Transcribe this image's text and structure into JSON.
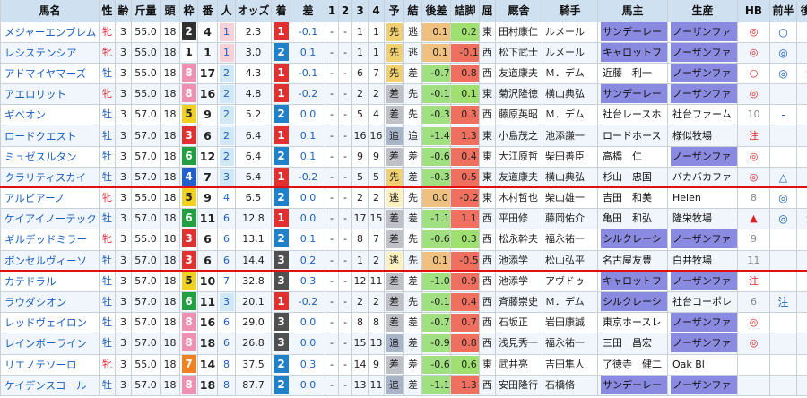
{
  "headers": [
    "馬名",
    "性",
    "齢",
    "斤量",
    "頭",
    "枠",
    "番",
    "人",
    "オッズ",
    "着",
    "差",
    "1",
    "2",
    "3",
    "4",
    "予",
    "結",
    "後差",
    "詰脚",
    "屈",
    "厩舎",
    "騎手",
    "馬主",
    "生産",
    "HB",
    "前半",
    "後半"
  ],
  "colors": {
    "waku": {
      "1": "#ffffff",
      "2": "#303030",
      "3": "#e03030",
      "4": "#2060d0",
      "5": "#f0d020",
      "6": "#20a040",
      "7": "#f08020",
      "8": "#f090b0"
    },
    "chaku": {
      "1": "#e03030",
      "2": "#2080c8",
      "3": "#505050",
      "other": "#f0f0f0"
    },
    "style_saki": "#f0d070",
    "style_sa": "#c0c0c8",
    "style_oi": "#a8b4c8",
    "style_nige": "#fff0c0",
    "owner_sunday": "#8a8ae0",
    "owner_carrot": "#8a8ae0",
    "farm_northern": "#8a8ae0",
    "kouhan_orange": "#f0c080",
    "kouhan_green": "#a0e080",
    "tsume_red": "#f07060",
    "tsume_green": "#a0e070",
    "owner_silk": "#8a8ae0",
    "ninki_pink": "#f8d0d8",
    "ninki_lightblue": "#d0e8f8"
  },
  "rows": [
    {
      "name": "メジャーエンブレム",
      "sex": "牝",
      "age": "3",
      "kin": "55.0",
      "tou": "18",
      "waku": "2",
      "ban": "4",
      "nin": "1",
      "odds": "2.3",
      "chaku": "1",
      "sa": "-0.1",
      "c1": "-",
      "c2": "-",
      "c3": "1",
      "c4": "1",
      "yo": "先",
      "ketsu": "逃",
      "kohan": "0.1",
      "kohan_c": "orange",
      "tsume": "0.2",
      "tsume_c": "green",
      "kutsu": "東",
      "stable": "田村康仁",
      "jockey": "ルメール",
      "owner": "サンデーレー",
      "owner_hl": true,
      "farm": "ノーザンファ",
      "farm_hl": true,
      "hb": "◎",
      "zen": "○",
      "kou": "▲"
    },
    {
      "name": "レシステンシア",
      "sex": "牝",
      "age": "3",
      "kin": "55.0",
      "tou": "18",
      "waku": "1",
      "ban": "1",
      "nin": "1",
      "odds": "3.0",
      "chaku": "2",
      "sa": "0.1",
      "c1": "-",
      "c2": "-",
      "c3": "1",
      "c4": "1",
      "yo": "先",
      "ketsu": "逃",
      "kohan": "0.1",
      "kohan_c": "orange",
      "tsume": "-0.1",
      "tsume_c": "red",
      "kutsu": "西",
      "stable": "松下武士",
      "jockey": "ルメール",
      "owner": "キャロットフ",
      "owner_hl": true,
      "farm": "ノーザンファ",
      "farm_hl": true,
      "hb": "◎",
      "zen": "◎",
      "kou": ""
    },
    {
      "name": "アドマイヤマーズ",
      "sex": "牡",
      "age": "3",
      "kin": "55.0",
      "tou": "18",
      "waku": "8",
      "ban": "17",
      "nin": "2",
      "odds": "4.3",
      "chaku": "1",
      "sa": "-0.1",
      "c1": "-",
      "c2": "-",
      "c3": "6",
      "c4": "7",
      "yo": "先",
      "ketsu": "差",
      "kohan": "-0.7",
      "kohan_c": "green",
      "tsume": "0.8",
      "tsume_c": "red",
      "kutsu": "西",
      "stable": "友道康夫",
      "jockey": "Ｍ．デム",
      "owner": "近藤　利一",
      "owner_hl": false,
      "farm": "ノーザンファ",
      "farm_hl": true,
      "hb": "○",
      "zen": "◎",
      "kou": "注"
    },
    {
      "name": "アエロリット",
      "sex": "牝",
      "age": "3",
      "kin": "55.0",
      "tou": "18",
      "waku": "8",
      "ban": "16",
      "nin": "2",
      "odds": "4.8",
      "chaku": "1",
      "sa": "-0.2",
      "c1": "-",
      "c2": "-",
      "c3": "2",
      "c4": "2",
      "yo": "差",
      "ketsu": "先",
      "kohan": "-0.1",
      "kohan_c": "green",
      "tsume": "0.1",
      "tsume_c": "green",
      "kutsu": "東",
      "stable": "菊沢隆徳",
      "jockey": "横山典弘",
      "owner": "サンデーレー",
      "owner_hl": true,
      "farm": "ノーザンファ",
      "farm_hl": true,
      "hb": "◎",
      "zen": "",
      "kou": "◎"
    },
    {
      "name": "ギベオン",
      "sex": "牡",
      "age": "3",
      "kin": "57.0",
      "tou": "18",
      "waku": "5",
      "ban": "9",
      "nin": "2",
      "odds": "5.2",
      "chaku": "2",
      "sa": "0.0",
      "c1": "-",
      "c2": "-",
      "c3": "5",
      "c4": "4",
      "yo": "差",
      "ketsu": "先",
      "kohan": "-0.3",
      "kohan_c": "green",
      "tsume": "0.3",
      "tsume_c": "red",
      "kutsu": "西",
      "stable": "藤原英昭",
      "jockey": "Ｍ．デム",
      "owner": "社台レースホ",
      "owner_hl": false,
      "farm": "社台ファーム",
      "farm_hl": false,
      "hb": "10",
      "zen": "-",
      "kou": "○"
    },
    {
      "name": "ロードクエスト",
      "sex": "牡",
      "age": "3",
      "kin": "57.0",
      "tou": "18",
      "waku": "3",
      "ban": "6",
      "nin": "2",
      "odds": "6.4",
      "chaku": "1",
      "sa": "0.1",
      "c1": "-",
      "c2": "-",
      "c3": "16",
      "c4": "16",
      "yo": "追",
      "ketsu": "追",
      "kohan": "-1.4",
      "kohan_c": "green",
      "tsume": "1.3",
      "tsume_c": "red",
      "kutsu": "東",
      "stable": "小島茂之",
      "jockey": "池添謙一",
      "owner": "ロードホース",
      "owner_hl": false,
      "farm": "様似牧場",
      "farm_hl": false,
      "hb": "注",
      "zen": "",
      "kou": "◎"
    },
    {
      "name": "ミュゼスルタン",
      "sex": "牡",
      "age": "3",
      "kin": "57.0",
      "tou": "18",
      "waku": "6",
      "ban": "12",
      "nin": "2",
      "odds": "6.4",
      "chaku": "2",
      "sa": "0.1",
      "c1": "-",
      "c2": "-",
      "c3": "9",
      "c4": "9",
      "yo": "差",
      "ketsu": "差",
      "kohan": "-0.6",
      "kohan_c": "green",
      "tsume": "0.4",
      "tsume_c": "red",
      "kutsu": "東",
      "stable": "大江原哲",
      "jockey": "柴田善臣",
      "owner": "高橋　仁",
      "owner_hl": false,
      "farm": "ノーザンファ",
      "farm_hl": true,
      "hb": "◎",
      "zen": "",
      "kou": "▲"
    },
    {
      "name": "クラリティスカイ",
      "sex": "牡",
      "age": "3",
      "kin": "57.0",
      "tou": "18",
      "waku": "4",
      "ban": "7",
      "nin": "3",
      "odds": "6.4",
      "chaku": "1",
      "sa": "-0.2",
      "c1": "-",
      "c2": "-",
      "c3": "5",
      "c4": "5",
      "yo": "先",
      "ketsu": "差",
      "kohan": "-0.3",
      "kohan_c": "green",
      "tsume": "0.5",
      "tsume_c": "red",
      "kutsu": "東",
      "stable": "友道康夫",
      "jockey": "横山典弘",
      "owner": "杉山　忠国",
      "owner_hl": false,
      "farm": "バカバカファ",
      "farm_hl": false,
      "hb": "◎",
      "zen": "△",
      "kou": "△"
    },
    {
      "name": "アルビアーノ",
      "sex": "牝",
      "age": "3",
      "kin": "55.0",
      "tou": "18",
      "waku": "5",
      "ban": "9",
      "nin": "4",
      "odds": "6.5",
      "chaku": "2",
      "sa": "0.0",
      "c1": "-",
      "c2": "-",
      "c3": "2",
      "c4": "2",
      "yo": "逃",
      "ketsu": "先",
      "kohan": "0.0",
      "kohan_c": "orange",
      "tsume": "-0.2",
      "tsume_c": "red",
      "kutsu": "東",
      "stable": "木村哲也",
      "jockey": "柴山雄一",
      "owner": "吉田　和美",
      "owner_hl": false,
      "farm": "Helen",
      "farm_hl": false,
      "hb": "8",
      "zen": "◎",
      "kou": ""
    },
    {
      "name": "ケイアイノーテック",
      "sex": "牡",
      "age": "3",
      "kin": "57.0",
      "tou": "18",
      "waku": "6",
      "ban": "11",
      "nin": "6",
      "odds": "12.8",
      "chaku": "1",
      "sa": "0.0",
      "c1": "-",
      "c2": "-",
      "c3": "17",
      "c4": "15",
      "yo": "差",
      "ketsu": "差",
      "kohan": "-1.1",
      "kohan_c": "green",
      "tsume": "1.1",
      "tsume_c": "red",
      "kutsu": "西",
      "stable": "平田修",
      "jockey": "藤岡佑介",
      "owner": "亀田　和弘",
      "owner_hl": false,
      "farm": "隆栄牧場",
      "farm_hl": false,
      "hb": "▲",
      "zen": "◎",
      "kou": "注"
    },
    {
      "name": "ギルデッドミラー",
      "sex": "牝",
      "age": "3",
      "kin": "55.0",
      "tou": "18",
      "waku": "3",
      "ban": "6",
      "nin": "6",
      "odds": "13.1",
      "chaku": "2",
      "sa": "0.1",
      "c1": "-",
      "c2": "-",
      "c3": "8",
      "c4": "7",
      "yo": "差",
      "ketsu": "先",
      "kohan": "-0.6",
      "kohan_c": "green",
      "tsume": "0.3",
      "tsume_c": "green",
      "kutsu": "西",
      "stable": "松永幹夫",
      "jockey": "福永祐一",
      "owner": "シルクレーシ",
      "owner_hl": true,
      "farm": "ノーザンファ",
      "farm_hl": true,
      "hb": "9",
      "zen": "",
      "kou": ""
    },
    {
      "name": "ボンセルヴィーソ",
      "sex": "牡",
      "age": "3",
      "kin": "57.0",
      "tou": "18",
      "waku": "3",
      "ban": "6",
      "nin": "6",
      "odds": "14.4",
      "chaku": "3",
      "sa": "0.2",
      "c1": "-",
      "c2": "-",
      "c3": "1",
      "c4": "2",
      "yo": "逃",
      "ketsu": "先",
      "kohan": "0.1",
      "kohan_c": "orange",
      "tsume": "-0.5",
      "tsume_c": "red",
      "kutsu": "西",
      "stable": "池添学",
      "jockey": "松山弘平",
      "owner": "名古屋友豊",
      "owner_hl": false,
      "farm": "白井牧場",
      "farm_hl": false,
      "hb": "11",
      "zen": "",
      "kou": ""
    },
    {
      "name": "カテドラル",
      "sex": "牡",
      "age": "3",
      "kin": "57.0",
      "tou": "18",
      "waku": "5",
      "ban": "10",
      "nin": "7",
      "odds": "32.8",
      "chaku": "3",
      "sa": "0.3",
      "c1": "-",
      "c2": "-",
      "c3": "12",
      "c4": "11",
      "yo": "差",
      "ketsu": "差",
      "kohan": "-1.0",
      "kohan_c": "green",
      "tsume": "0.9",
      "tsume_c": "red",
      "kutsu": "西",
      "stable": "池添学",
      "jockey": "アヴドゥ",
      "owner": "キャロットフ",
      "owner_hl": true,
      "farm": "ノーザンファ",
      "farm_hl": true,
      "hb": "注",
      "zen": "",
      "kou": ""
    },
    {
      "name": "ラウダシオン",
      "sex": "牡",
      "age": "3",
      "kin": "57.0",
      "tou": "18",
      "waku": "6",
      "ban": "11",
      "nin": "3",
      "odds": "20.1",
      "chaku": "1",
      "sa": "-0.2",
      "c1": "-",
      "c2": "-",
      "c3": "2",
      "c4": "2",
      "yo": "差",
      "ketsu": "先",
      "kohan": "-0.1",
      "kohan_c": "green",
      "tsume": "0.4",
      "tsume_c": "red",
      "kutsu": "西",
      "stable": "斉藤崇史",
      "jockey": "Ｍ．デム",
      "owner": "シルクレーシ",
      "owner_hl": true,
      "farm": "社台コーポレ",
      "farm_hl": false,
      "hb": "6",
      "zen": "注",
      "kou": ""
    },
    {
      "name": "レッドヴェイロン",
      "sex": "牡",
      "age": "3",
      "kin": "57.0",
      "tou": "18",
      "waku": "8",
      "ban": "16",
      "nin": "6",
      "odds": "29.0",
      "chaku": "3",
      "sa": "0.0",
      "c1": "-",
      "c2": "-",
      "c3": "8",
      "c4": "8",
      "yo": "差",
      "ketsu": "差",
      "kohan": "-0.7",
      "kohan_c": "green",
      "tsume": "0.7",
      "tsume_c": "red",
      "kutsu": "西",
      "stable": "石坂正",
      "jockey": "岩田康誠",
      "owner": "東京ホースレ",
      "owner_hl": false,
      "farm": "ノーザンファ",
      "farm_hl": true,
      "hb": "◎",
      "zen": "",
      "kou": "▲"
    },
    {
      "name": "レインボーライン",
      "sex": "牡",
      "age": "3",
      "kin": "57.0",
      "tou": "18",
      "waku": "8",
      "ban": "18",
      "nin": "6",
      "odds": "26.8",
      "chaku": "3",
      "sa": "0.0",
      "c1": "-",
      "c2": "-",
      "c3": "15",
      "c4": "13",
      "yo": "追",
      "ketsu": "差",
      "kohan": "-0.9",
      "kohan_c": "green",
      "tsume": "0.8",
      "tsume_c": "red",
      "kutsu": "西",
      "stable": "浅見秀一",
      "jockey": "福永祐一",
      "owner": "三田　昌宏",
      "owner_hl": false,
      "farm": "ノーザンファ",
      "farm_hl": true,
      "hb": "◎",
      "zen": "",
      "kou": "◎"
    },
    {
      "name": "リエノテソーロ",
      "sex": "牝",
      "age": "3",
      "kin": "55.0",
      "tou": "18",
      "waku": "7",
      "ban": "14",
      "nin": "8",
      "odds": "37.5",
      "chaku": "2",
      "sa": "0.3",
      "c1": "-",
      "c2": "-",
      "c3": "14",
      "c4": "9",
      "yo": "差",
      "ketsu": "差",
      "kohan": "-0.6",
      "kohan_c": "green",
      "tsume": "0.6",
      "tsume_c": "green",
      "kutsu": "東",
      "stable": "武井亮",
      "jockey": "吉田隼人",
      "owner": "了徳寺　健二",
      "owner_hl": false,
      "farm": "Oak Bl",
      "farm_hl": false,
      "hb": "",
      "zen": "",
      "kou": "○"
    },
    {
      "name": "ケイデンスコール",
      "sex": "牡",
      "age": "3",
      "kin": "57.0",
      "tou": "18",
      "waku": "8",
      "ban": "18",
      "nin": "8",
      "odds": "87.7",
      "chaku": "2",
      "sa": "0.0",
      "c1": "-",
      "c2": "-",
      "c3": "13",
      "c4": "11",
      "yo": "追",
      "ketsu": "差",
      "kohan": "-1.1",
      "kohan_c": "green",
      "tsume": "1.3",
      "tsume_c": "red",
      "kutsu": "西",
      "stable": "安田隆行",
      "jockey": "石橋脩",
      "owner": "サンデーレー",
      "owner_hl": true,
      "farm": "ノーザンファ",
      "farm_hl": true,
      "hb": "",
      "zen": "",
      "kou": "▲"
    }
  ]
}
